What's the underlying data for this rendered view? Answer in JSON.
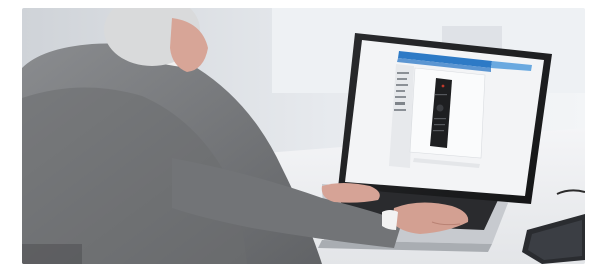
{
  "scene": {
    "description": "",
    "palette": {
      "wall": "#dfe2e6",
      "window_light": "#f4f6f8",
      "suit": "#7d7f82",
      "suit_dark": "#5f6164",
      "skin": "#d8a79a",
      "hair": "#d9dadb",
      "laptop_body": "#c9ccd0",
      "laptop_bezel": "#1b1c1e",
      "screen_bg": "#f2f3f5",
      "ui_blue": "#2d7ac6",
      "remote": "#1e1f21",
      "desk": "#eef0f2"
    }
  },
  "screen_ui": {
    "header_label": "",
    "sidebar_items": [
      "",
      "",
      "",
      "",
      "",
      "",
      ""
    ]
  }
}
